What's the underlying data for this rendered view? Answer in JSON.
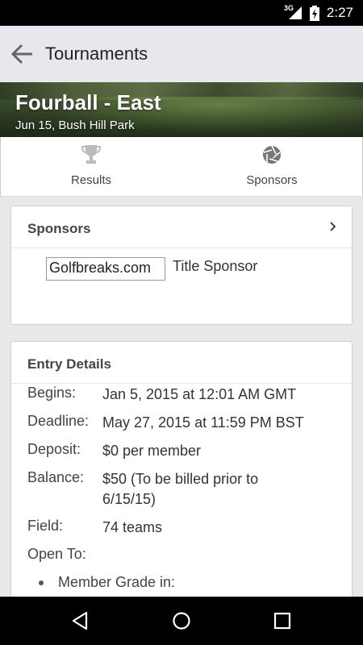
{
  "status_bar": {
    "network": "3G",
    "time": "2:27"
  },
  "app_bar": {
    "title": "Tournaments"
  },
  "hero": {
    "name": "Fourball - East",
    "subtitle": "Jun 15, Bush Hill Park"
  },
  "tabs": [
    {
      "label": "Results",
      "icon": "trophy-icon"
    },
    {
      "label": "Sponsors",
      "icon": "aperture-icon"
    }
  ],
  "sponsors_card": {
    "title": "Sponsors",
    "sponsor_name": "Golfbreaks.com",
    "sponsor_role": "Title Sponsor"
  },
  "entry_card": {
    "title": "Entry Details",
    "rows": [
      {
        "label": "Begins:",
        "value": "Jan 5, 2015 at 12:01 AM GMT"
      },
      {
        "label": "Deadline:",
        "value": "May 27, 2015 at 11:59 PM BST"
      },
      {
        "label": "Deposit:",
        "value": "$0 per member"
      },
      {
        "label": "Balance:",
        "value": "$50 (To be billed prior to 6/15/15)"
      },
      {
        "label": "Field:",
        "value": "74 teams"
      },
      {
        "label": "Open To:",
        "value": ""
      }
    ],
    "bullet": "Member Grade in:"
  },
  "nav_bar": {
    "back_icon": "triangle-back-icon",
    "home_icon": "circle-home-icon",
    "recents_icon": "square-recents-icon"
  }
}
